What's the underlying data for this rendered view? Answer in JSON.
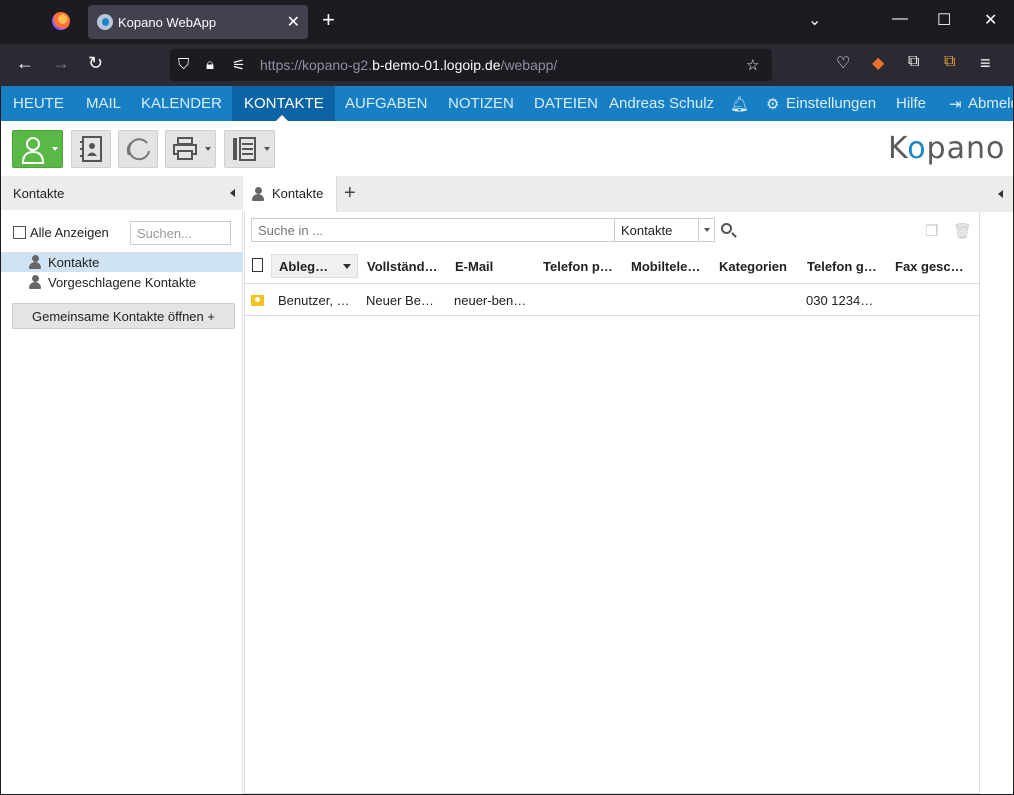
{
  "browser": {
    "tab_title": "Kopano WebApp",
    "url_prefix": "https://kopano-g2.",
    "url_domain": "b-demo-01.logoip.de",
    "url_suffix": "/webapp/"
  },
  "topnav": {
    "items": [
      "HEUTE",
      "MAIL",
      "KALENDER",
      "KONTAKTE",
      "AUFGABEN",
      "NOTIZEN",
      "DATEIEN"
    ],
    "active": "KONTAKTE",
    "user": "Andreas Schulz",
    "settings": "Einstellungen",
    "help": "Hilfe",
    "logout": "Abmelden"
  },
  "logo": {
    "text_k": "K",
    "text_o": "o",
    "text_rest": "pano"
  },
  "leftpanel": {
    "title": "Kontakte",
    "show_all": "Alle Anzeigen",
    "search_placeholder": "Suchen...",
    "folders": [
      "Kontakte",
      "Vorgeschlagene Kontakte"
    ],
    "open_shared": "Gemeinsame Kontakte öffnen +"
  },
  "main": {
    "tab_label": "Kontakte",
    "search_placeholder": "Suche in ...",
    "search_scope": "Kontakte",
    "columns": [
      "Ableg…",
      "Vollständ…",
      "E-Mail",
      "Telefon p…",
      "Mobiltele…",
      "Kategorien",
      "Telefon g…",
      "Fax gesc…"
    ],
    "rows": [
      {
        "file_as": "Benutzer, …",
        "full_name": "Neuer Be…",
        "email": "neuer-ben…",
        "phone_private": "",
        "mobile": "",
        "categories": "",
        "phone_business": "030 1234…",
        "fax": ""
      }
    ]
  },
  "colors": {
    "nav_bg": "#1780c5",
    "nav_active": "#0d64a4",
    "new_button": "#5ab946",
    "contact_icon": "#f3c320"
  }
}
